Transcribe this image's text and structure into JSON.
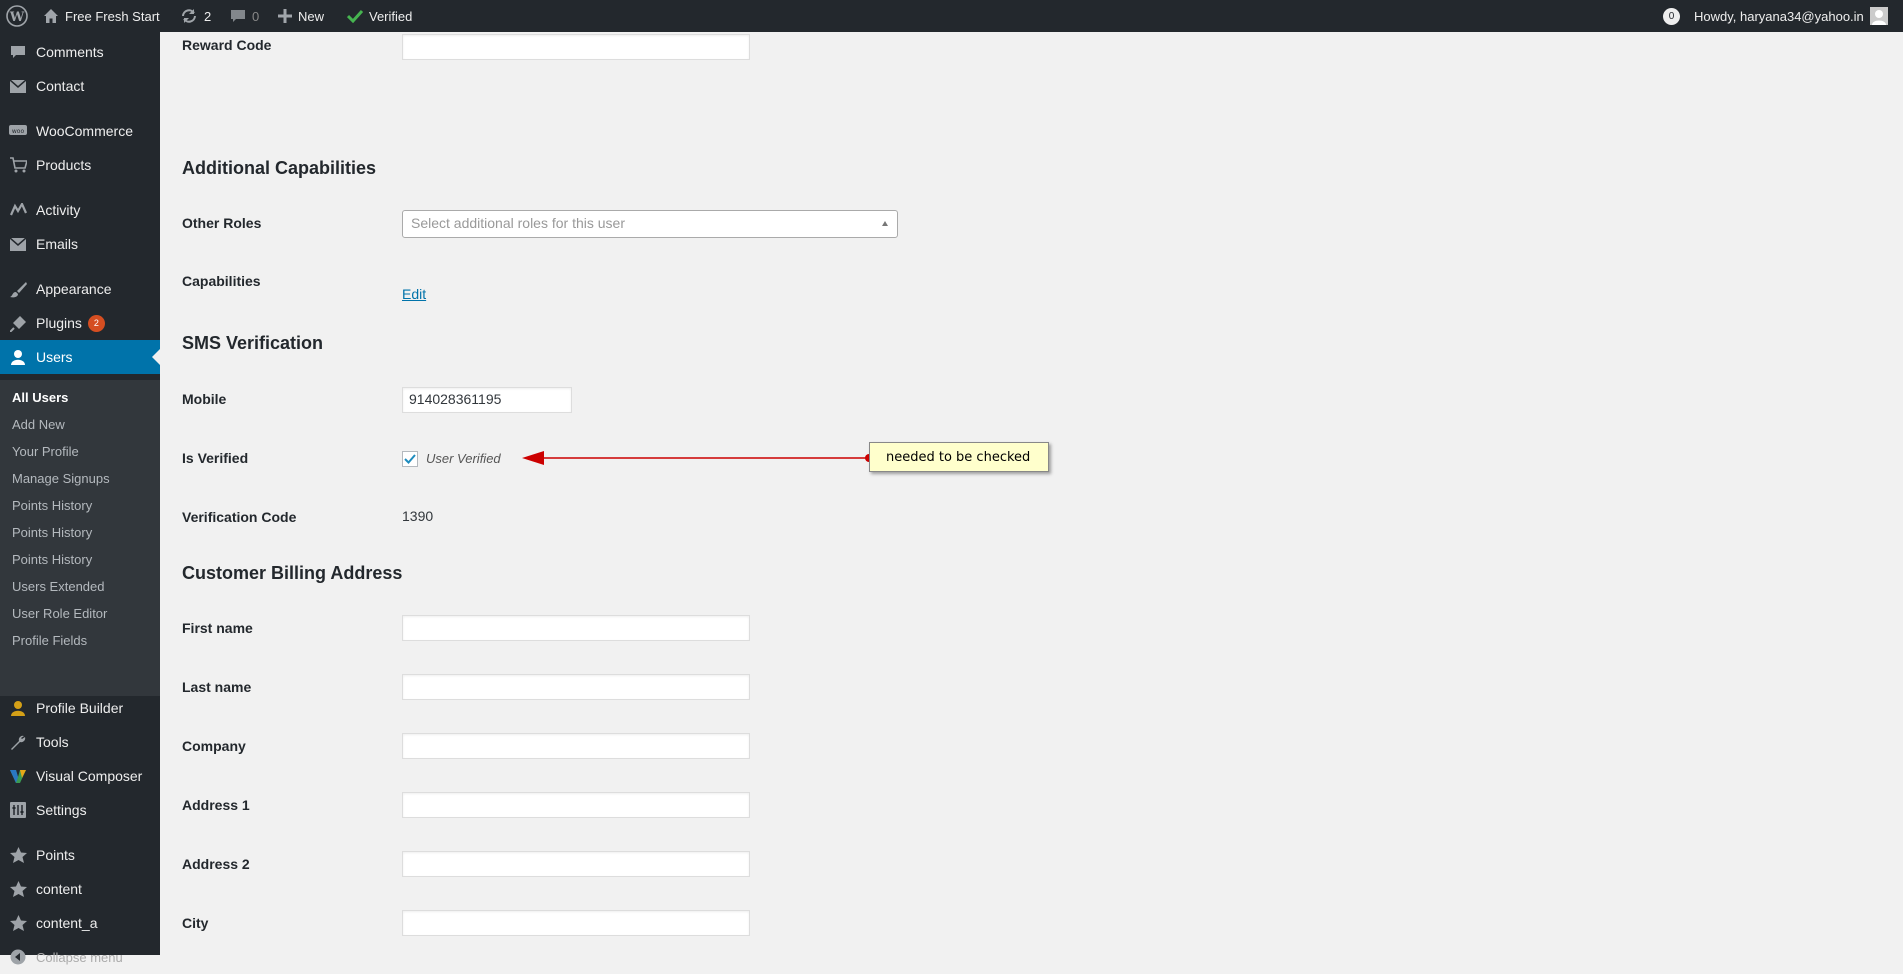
{
  "adminbar": {
    "site_name": "Free Fresh Start",
    "updates_count": "2",
    "comments_count": "0",
    "new_label": "New",
    "verified_label": "Verified",
    "notifications_count": "0",
    "howdy": "Howdy, haryana34@yahoo.in"
  },
  "sidebar": {
    "items": [
      {
        "label": "Comments",
        "icon": "comment-icon"
      },
      {
        "label": "Contact",
        "icon": "mail-icon"
      },
      {
        "label": "WooCommerce",
        "icon": "woo-icon"
      },
      {
        "label": "Products",
        "icon": "cart-icon"
      },
      {
        "label": "Activity",
        "icon": "activity-icon"
      },
      {
        "label": "Emails",
        "icon": "mail-icon"
      },
      {
        "label": "Appearance",
        "icon": "brush-icon"
      },
      {
        "label": "Plugins",
        "icon": "plugin-icon",
        "badge": "2"
      },
      {
        "label": "Users",
        "icon": "user-icon"
      },
      {
        "label": "Profile Builder",
        "icon": "user-icon"
      },
      {
        "label": "Tools",
        "icon": "wrench-icon"
      },
      {
        "label": "Visual Composer",
        "icon": "vc-icon"
      },
      {
        "label": "Settings",
        "icon": "settings-icon"
      },
      {
        "label": "Points",
        "icon": "star-icon"
      },
      {
        "label": "content",
        "icon": "star-icon"
      },
      {
        "label": "content_a",
        "icon": "star-icon"
      },
      {
        "label": "Collapse menu",
        "icon": "collapse-icon"
      }
    ],
    "submenu": [
      "All Users",
      "Add New",
      "Your Profile",
      "Manage Signups",
      "Points History",
      "Points History",
      "Points History",
      "Users Extended",
      "User Role Editor",
      "Profile Fields"
    ]
  },
  "form": {
    "reward_code_label": "Reward Code",
    "additional_caps_title": "Additional Capabilities",
    "other_roles_label": "Other Roles",
    "other_roles_placeholder": "Select additional roles for this user",
    "capabilities_label": "Capabilities",
    "capabilities_edit": "Edit",
    "sms_title": "SMS Verification",
    "mobile_label": "Mobile",
    "mobile_value": "914028361195",
    "is_verified_label": "Is Verified",
    "user_verified_label": "User Verified",
    "user_verified_checked": true,
    "verification_code_label": "Verification Code",
    "verification_code_value": "1390",
    "billing_title": "Customer Billing Address",
    "first_name_label": "First name",
    "last_name_label": "Last name",
    "company_label": "Company",
    "address1_label": "Address 1",
    "address2_label": "Address 2",
    "city_label": "City"
  },
  "annotation": {
    "text": "needed to be checked",
    "arrow_color": "#cc0000"
  },
  "colors": {
    "adminbar_bg": "#23282d",
    "accent": "#0073aa",
    "badge": "#d54e21"
  }
}
